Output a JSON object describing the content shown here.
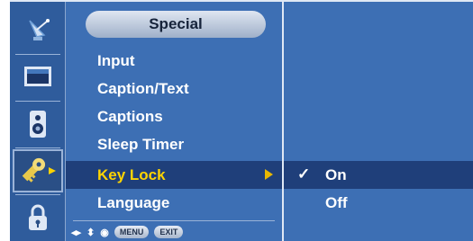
{
  "menu": {
    "title": "Special",
    "items": [
      {
        "label": "Input"
      },
      {
        "label": "Caption/Text"
      },
      {
        "label": "Captions"
      },
      {
        "label": "Sleep Timer"
      },
      {
        "label": "Key Lock",
        "selected": true
      },
      {
        "label": "Language"
      }
    ]
  },
  "submenu": {
    "items": [
      {
        "label": "On",
        "checked": true
      },
      {
        "label": "Off"
      }
    ]
  },
  "hints": {
    "move_glyph": "◂▸",
    "updown_glyph": "⬍",
    "ok_glyph": "◉",
    "menu_label": "MENU",
    "exit_label": "EXIT"
  },
  "rail_icons": [
    "satellite-icon",
    "picture-icon",
    "speaker-icon",
    "key-icon",
    "lock-icon"
  ],
  "colors": {
    "background": "#3d6fb4",
    "selected_row": "#1f3f7a",
    "selected_text": "#ffd400"
  }
}
